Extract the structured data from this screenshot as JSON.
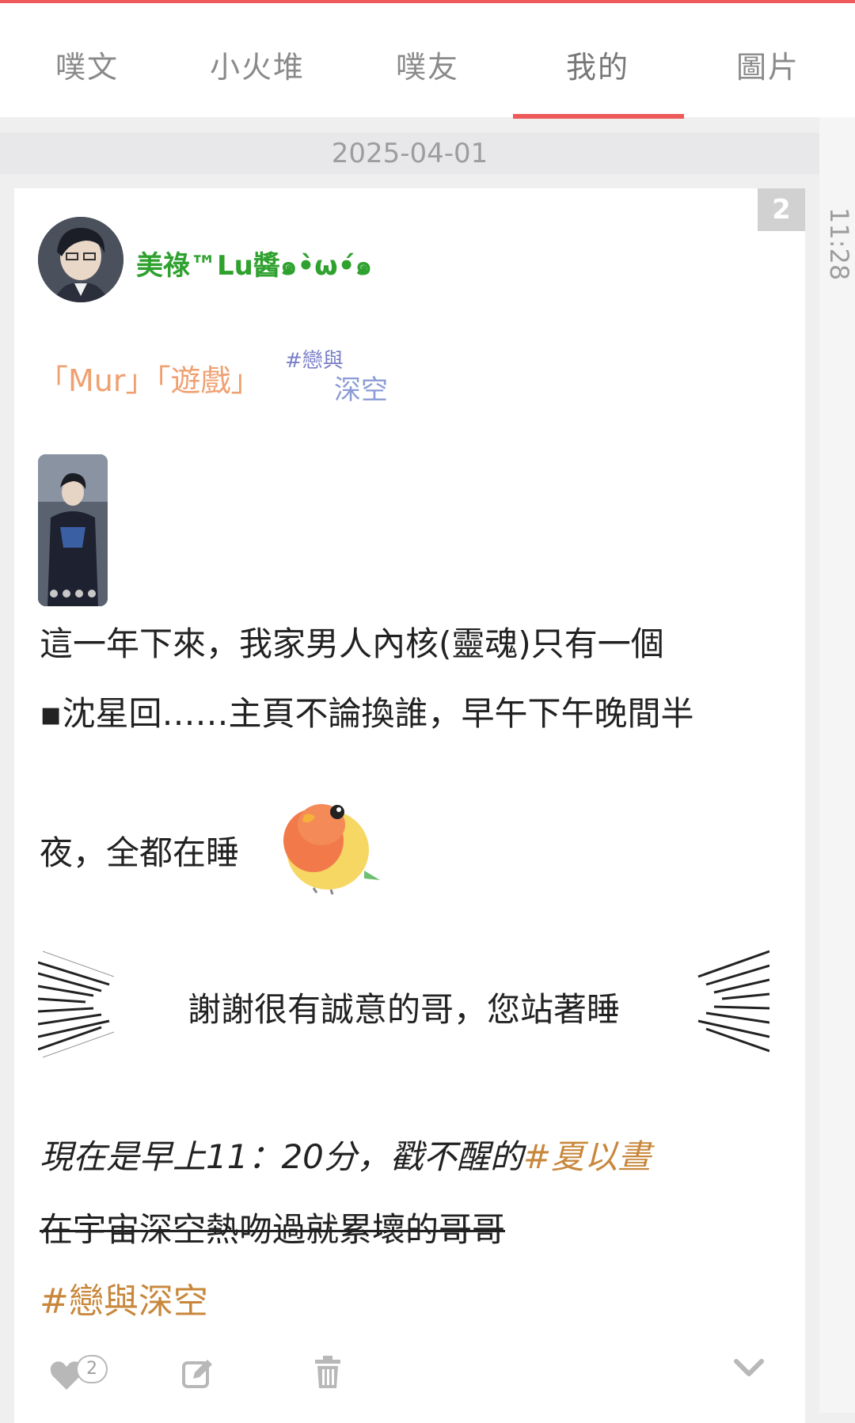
{
  "tabs": [
    {
      "label": "噗文",
      "active": false
    },
    {
      "label": "小火堆",
      "active": false
    },
    {
      "label": "噗友",
      "active": false
    },
    {
      "label": "我的",
      "active": true
    },
    {
      "label": "圖片",
      "active": false
    }
  ],
  "colors": {
    "accent": "#ee5a59",
    "username": "#2fa12f",
    "hashtag": "#c8873b",
    "muted": "#9d9d9d"
  },
  "date_header": "2025-04-01",
  "side_time": "11:28",
  "post": {
    "response_count": "2",
    "username": "美祿™Lu醬๑•̀ω•́๑",
    "tag_banner": {
      "left": "「Mur」「遊戲」",
      "right_top": "#戀與",
      "right_bottom": "深空"
    },
    "line1": "這一年下來，我家男人內核(靈魂)只有一個",
    "line2": "▪沈星回……主頁不論換誰，早午下午晚間半",
    "line3": "夜，全都在睡",
    "quote": "謝謝很有誠意的哥，您站著睡",
    "italic_prefix": "現在是早上11：20分，戳不醒的",
    "italic_tag": "#夏以晝",
    "strikethrough": "在宇宙深空熱吻過就累壞的哥哥",
    "hashtag": "#戀與深空",
    "like_count": "2"
  },
  "icons": {
    "like": "heart-icon",
    "edit": "edit-icon",
    "delete": "trash-icon",
    "more": "chevron-down-icon"
  }
}
